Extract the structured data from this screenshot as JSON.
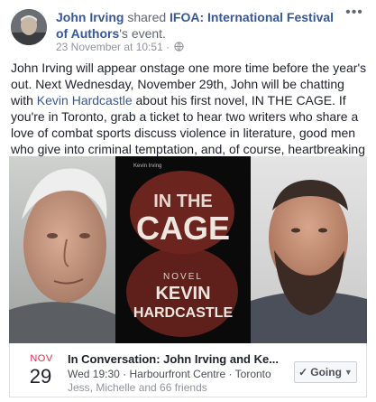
{
  "post": {
    "author": "John Irving",
    "shared_word": "shared",
    "page_name": "IFOA: International Festival of Authors",
    "suffix": "'s event.",
    "timestamp": "23 November at 10:51",
    "separator": "·",
    "body_part1": "John Irving will appear onstage one more time before the year's out. Next Wednesday, November 29th, John will be chatting with ",
    "mention": "Kevin Hardcastle",
    "body_part2": " about his first novel, IN THE CAGE. If you're in Toronto, grab a ticket to hear two writers who share a love of combat sports discuss violence in literature, good men who give into criminal temptation, and, of course, heartbreaking endings."
  },
  "book": {
    "author_small": "Kevin Irving",
    "title_line1": "IN THE",
    "title_line2": "CAGE",
    "novel": "NOVEL",
    "author_line1": "KEVIN",
    "author_line2": "HARDCASTLE"
  },
  "event": {
    "month": "NOV",
    "day": "29",
    "title": "In Conversation: John Irving and Ke...",
    "details": "Wed 19:30 · Harbourfront Centre · Toronto",
    "friends": "Jess, Michelle and 66 friends",
    "going_label": "Going"
  },
  "icons": {
    "more": "more-options-icon",
    "globe": "globe-icon",
    "check": "check-icon",
    "caret": "caret-down-icon"
  },
  "colors": {
    "link": "#365899",
    "month": "#f02849",
    "meta": "#90949c"
  }
}
